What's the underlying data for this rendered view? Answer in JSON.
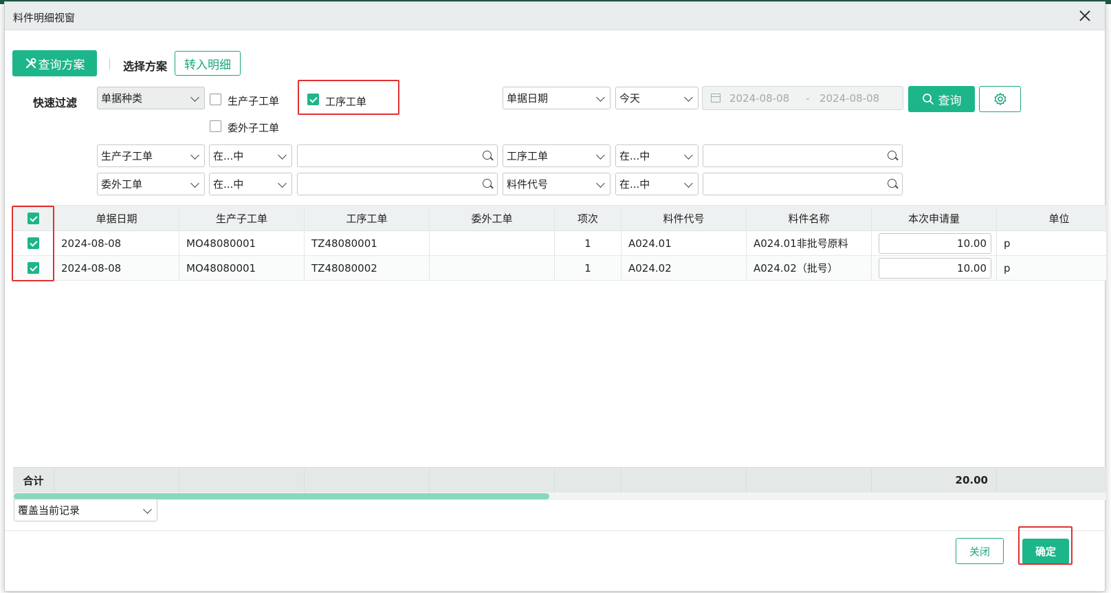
{
  "window": {
    "title": "料件明细视窗"
  },
  "toolbar": {
    "query_scheme_label": "查询方案",
    "select_scheme_label": "选择方案",
    "transfer_detail_label": "转入明细"
  },
  "filter": {
    "quick_filter_label": "快速过滤",
    "doc_type_select": "单据种类",
    "checkboxes": [
      {
        "label": "生产子工单",
        "checked": false
      },
      {
        "label": "工序工单",
        "checked": true
      },
      {
        "label": "委外子工单",
        "checked": false
      }
    ],
    "date_field_select": "单据日期",
    "date_preset_select": "今天",
    "date_from": "2024-08-08",
    "date_sep": "-",
    "date_to": "2024-08-08",
    "query_label": "查询",
    "conditions": [
      {
        "field": "生产子工单",
        "op": "在...中",
        "value": ""
      },
      {
        "field": "工序工单",
        "op": "在...中",
        "value": ""
      },
      {
        "field": "委外工单",
        "op": "在...中",
        "value": ""
      },
      {
        "field": "料件代号",
        "op": "在...中",
        "value": ""
      }
    ]
  },
  "table": {
    "columns": [
      "单据日期",
      "生产子工单",
      "工序工单",
      "委外工单",
      "项次",
      "料件代号",
      "料件名称",
      "本次申请量",
      "单位"
    ],
    "header_checked": true,
    "rows": [
      {
        "checked": true,
        "date": "2024-08-08",
        "prod_order": "MO48080001",
        "process_order": "TZ48080001",
        "outsource_order": "",
        "seq": "1",
        "item_code": "A024.01",
        "item_name": "A024.01非批号原料",
        "qty": "10.00",
        "unit": "p"
      },
      {
        "checked": true,
        "date": "2024-08-08",
        "prod_order": "MO48080001",
        "process_order": "TZ48080002",
        "outsource_order": "",
        "seq": "1",
        "item_code": "A024.02",
        "item_name": "A024.02（批号）",
        "qty": "10.00",
        "unit": "p"
      }
    ],
    "footer": {
      "label": "合计",
      "qty_total": "20.00"
    },
    "scroll_fraction": 0.49
  },
  "bottom": {
    "mode_select": "覆盖当前记录",
    "close_label": "关闭",
    "confirm_label": "确定"
  },
  "colors": {
    "accent": "#1db58a",
    "highlight": "#e03030"
  },
  "icons": [
    "close-icon",
    "tools-icon",
    "search-icon",
    "gear-icon",
    "calendar-icon",
    "chevron-down-icon",
    "check-icon"
  ]
}
